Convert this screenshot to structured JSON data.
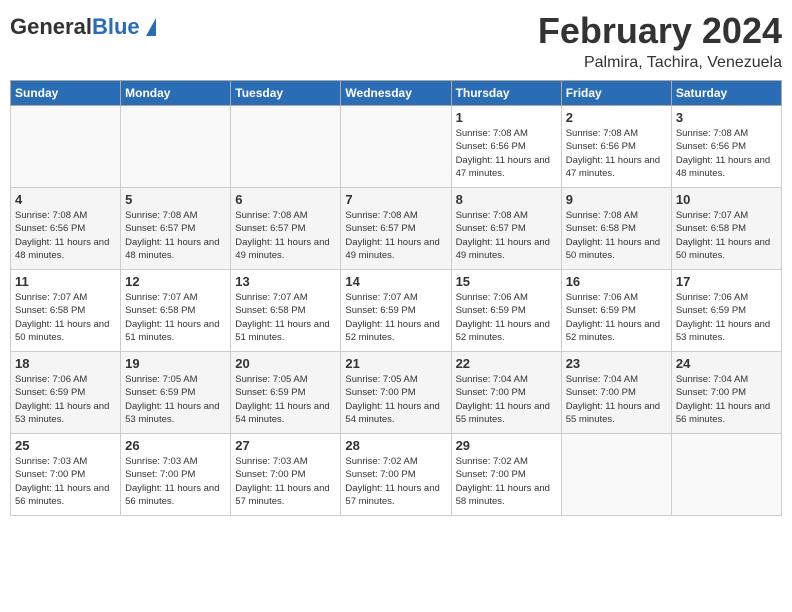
{
  "logo": {
    "general": "General",
    "blue": "Blue"
  },
  "title": "February 2024",
  "location": "Palmira, Tachira, Venezuela",
  "days_of_week": [
    "Sunday",
    "Monday",
    "Tuesday",
    "Wednesday",
    "Thursday",
    "Friday",
    "Saturday"
  ],
  "weeks": [
    [
      {
        "day": "",
        "info": ""
      },
      {
        "day": "",
        "info": ""
      },
      {
        "day": "",
        "info": ""
      },
      {
        "day": "",
        "info": ""
      },
      {
        "day": "1",
        "info": "Sunrise: 7:08 AM\nSunset: 6:56 PM\nDaylight: 11 hours\nand 47 minutes."
      },
      {
        "day": "2",
        "info": "Sunrise: 7:08 AM\nSunset: 6:56 PM\nDaylight: 11 hours\nand 47 minutes."
      },
      {
        "day": "3",
        "info": "Sunrise: 7:08 AM\nSunset: 6:56 PM\nDaylight: 11 hours\nand 48 minutes."
      }
    ],
    [
      {
        "day": "4",
        "info": "Sunrise: 7:08 AM\nSunset: 6:56 PM\nDaylight: 11 hours\nand 48 minutes."
      },
      {
        "day": "5",
        "info": "Sunrise: 7:08 AM\nSunset: 6:57 PM\nDaylight: 11 hours\nand 48 minutes."
      },
      {
        "day": "6",
        "info": "Sunrise: 7:08 AM\nSunset: 6:57 PM\nDaylight: 11 hours\nand 49 minutes."
      },
      {
        "day": "7",
        "info": "Sunrise: 7:08 AM\nSunset: 6:57 PM\nDaylight: 11 hours\nand 49 minutes."
      },
      {
        "day": "8",
        "info": "Sunrise: 7:08 AM\nSunset: 6:57 PM\nDaylight: 11 hours\nand 49 minutes."
      },
      {
        "day": "9",
        "info": "Sunrise: 7:08 AM\nSunset: 6:58 PM\nDaylight: 11 hours\nand 50 minutes."
      },
      {
        "day": "10",
        "info": "Sunrise: 7:07 AM\nSunset: 6:58 PM\nDaylight: 11 hours\nand 50 minutes."
      }
    ],
    [
      {
        "day": "11",
        "info": "Sunrise: 7:07 AM\nSunset: 6:58 PM\nDaylight: 11 hours\nand 50 minutes."
      },
      {
        "day": "12",
        "info": "Sunrise: 7:07 AM\nSunset: 6:58 PM\nDaylight: 11 hours\nand 51 minutes."
      },
      {
        "day": "13",
        "info": "Sunrise: 7:07 AM\nSunset: 6:58 PM\nDaylight: 11 hours\nand 51 minutes."
      },
      {
        "day": "14",
        "info": "Sunrise: 7:07 AM\nSunset: 6:59 PM\nDaylight: 11 hours\nand 52 minutes."
      },
      {
        "day": "15",
        "info": "Sunrise: 7:06 AM\nSunset: 6:59 PM\nDaylight: 11 hours\nand 52 minutes."
      },
      {
        "day": "16",
        "info": "Sunrise: 7:06 AM\nSunset: 6:59 PM\nDaylight: 11 hours\nand 52 minutes."
      },
      {
        "day": "17",
        "info": "Sunrise: 7:06 AM\nSunset: 6:59 PM\nDaylight: 11 hours\nand 53 minutes."
      }
    ],
    [
      {
        "day": "18",
        "info": "Sunrise: 7:06 AM\nSunset: 6:59 PM\nDaylight: 11 hours\nand 53 minutes."
      },
      {
        "day": "19",
        "info": "Sunrise: 7:05 AM\nSunset: 6:59 PM\nDaylight: 11 hours\nand 53 minutes."
      },
      {
        "day": "20",
        "info": "Sunrise: 7:05 AM\nSunset: 6:59 PM\nDaylight: 11 hours\nand 54 minutes."
      },
      {
        "day": "21",
        "info": "Sunrise: 7:05 AM\nSunset: 7:00 PM\nDaylight: 11 hours\nand 54 minutes."
      },
      {
        "day": "22",
        "info": "Sunrise: 7:04 AM\nSunset: 7:00 PM\nDaylight: 11 hours\nand 55 minutes."
      },
      {
        "day": "23",
        "info": "Sunrise: 7:04 AM\nSunset: 7:00 PM\nDaylight: 11 hours\nand 55 minutes."
      },
      {
        "day": "24",
        "info": "Sunrise: 7:04 AM\nSunset: 7:00 PM\nDaylight: 11 hours\nand 56 minutes."
      }
    ],
    [
      {
        "day": "25",
        "info": "Sunrise: 7:03 AM\nSunset: 7:00 PM\nDaylight: 11 hours\nand 56 minutes."
      },
      {
        "day": "26",
        "info": "Sunrise: 7:03 AM\nSunset: 7:00 PM\nDaylight: 11 hours\nand 56 minutes."
      },
      {
        "day": "27",
        "info": "Sunrise: 7:03 AM\nSunset: 7:00 PM\nDaylight: 11 hours\nand 57 minutes."
      },
      {
        "day": "28",
        "info": "Sunrise: 7:02 AM\nSunset: 7:00 PM\nDaylight: 11 hours\nand 57 minutes."
      },
      {
        "day": "29",
        "info": "Sunrise: 7:02 AM\nSunset: 7:00 PM\nDaylight: 11 hours\nand 58 minutes."
      },
      {
        "day": "",
        "info": ""
      },
      {
        "day": "",
        "info": ""
      }
    ]
  ]
}
